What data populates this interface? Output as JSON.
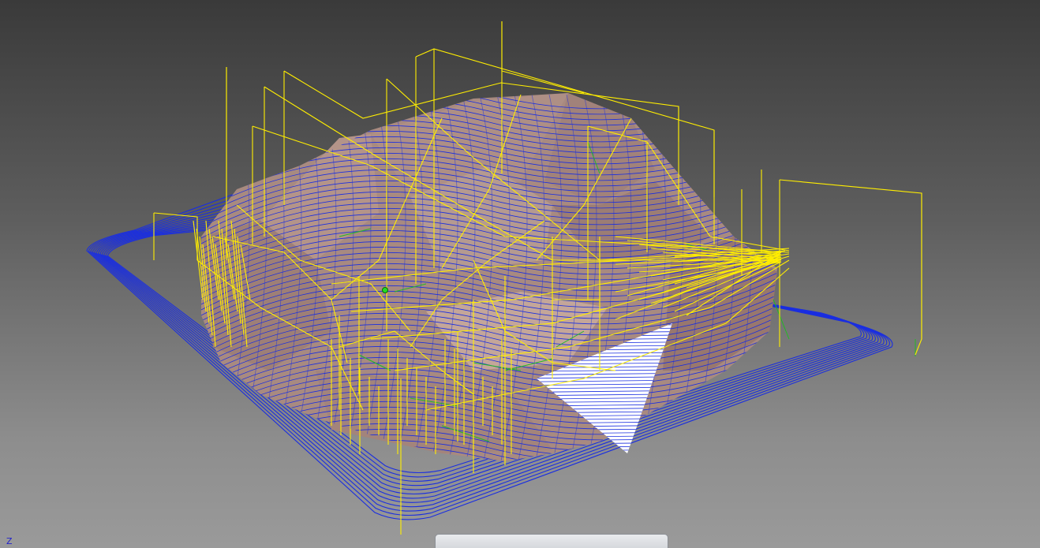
{
  "viewport": {
    "axis_label": "Z"
  },
  "colors": {
    "background_top": "#3a3a3a",
    "background_bottom": "#9a9a9a",
    "part_surface": "#a88a80",
    "toolpath_cut": "#1a2ee0",
    "toolpath_rapid": "#ffee00",
    "toolpath_link": "#22bb22",
    "uncut_region": "#ffffff"
  }
}
